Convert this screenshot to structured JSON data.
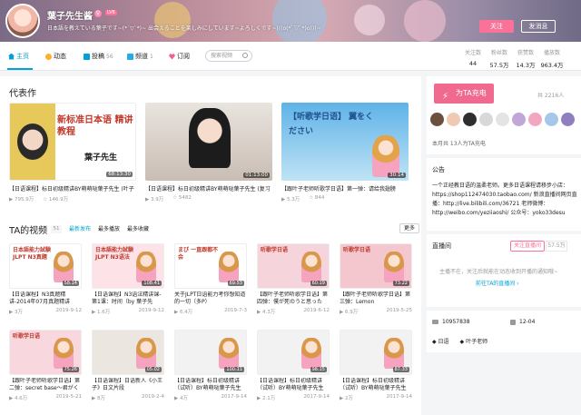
{
  "header": {
    "username": "葉子先生酱",
    "level": "LV6",
    "signature": "日本語を教えている葉子です~(*´▽`*)~ 出会えることを楽しみにしています~よろしくです~(((o(*ﾟ▽ﾟ*)o)))~",
    "follow_label": "关注",
    "message_label": "发消息"
  },
  "nav": {
    "items": [
      {
        "label": "主页",
        "count": "",
        "icon": "home-icon"
      },
      {
        "label": "动态",
        "count": "",
        "icon": "feed-icon"
      },
      {
        "label": "投稿",
        "count": "56",
        "icon": "upload-icon"
      },
      {
        "label": "频道",
        "count": "1",
        "icon": "channel-icon"
      },
      {
        "label": "订阅",
        "count": "",
        "icon": "subscribe-icon"
      }
    ],
    "search_placeholder": "搜索视频",
    "stats": [
      {
        "label": "关注数",
        "value": "44"
      },
      {
        "label": "粉丝数",
        "value": "57.5万"
      },
      {
        "label": "获赞数",
        "value": "14.3万"
      },
      {
        "label": "播放数",
        "value": "963.4万"
      }
    ]
  },
  "representative": {
    "title": "代表作",
    "videos": [
      {
        "title": "【日语课程】标日初级精讲BY萌萌哒葉子先生 (叶子",
        "duration": "68:13:30",
        "plays": "795.9万",
        "favs": "146.9万",
        "thumb_text": "新标准日本语 精讲教程",
        "sub": "葉子先生"
      },
      {
        "title": "【日语课程】标日初级精讲BY萌萌哒葉子先生 (复习",
        "duration": "01:13:00",
        "plays": "3.9万",
        "favs": "5482",
        "thumb_text": "",
        "sub": ""
      },
      {
        "title": "【跟叶子老师听歌学日语】第一弹：请给我翅膀",
        "duration": "30:14",
        "plays": "5.3万",
        "favs": "844",
        "thumb_text": "【听歌学日语】 翼をください",
        "sub": ""
      }
    ]
  },
  "ta_videos": {
    "title": "TA的视频",
    "count": "51",
    "tabs": [
      "最新发布",
      "最多播放",
      "最多收藏"
    ],
    "more_label": "更多",
    "rows": [
      [
        {
          "title": "【日语课程】N3真题精讲-2014年07月真题精讲（by",
          "duration": "58:14",
          "plays": "3万",
          "date": "2019-9-12",
          "thumb_text": "日本語能力試験 JLPT N3真題"
        },
        {
          "title": "【日语课程】N3语法精讲课-第1课：时间（by 葉子先",
          "duration": "108:41",
          "plays": "1.6万",
          "date": "2019-9-12",
          "thumb_text": "日本語能力試験 JLPT N3语法"
        },
        {
          "title": "关于JLPT日语能力考你想知道的一切（多P）",
          "duration": "69:53",
          "plays": "6.4万",
          "date": "2019-7-3",
          "thumb_text": "まび 一直跟都不会"
        },
        {
          "title": "【跟叶子老师听歌学日语】第四弹：僕が死のうと思った",
          "duration": "60:19",
          "plays": "4.3万",
          "date": "2019-6-12",
          "thumb_text": "听歌学日语"
        },
        {
          "title": "【跟叶子老师听歌学日语】第三弹：Lemon",
          "duration": "73:22",
          "plays": "6.9万",
          "date": "2019-5-25",
          "thumb_text": "听歌学日语"
        }
      ],
      [
        {
          "title": "【跟叶子老师听歌学日语】第二弹：secret base～君がく",
          "duration": "75:26",
          "plays": "4.6万",
          "date": "2019-5-21",
          "thumb_text": "听歌学日语"
        },
        {
          "title": "【日语课程】日语新人《小王子》日文片段",
          "duration": "05:02",
          "plays": "8万",
          "date": "2019-2-4",
          "thumb_text": ""
        },
        {
          "title": "【日语课程】标日初级精讲（试听）BY萌萌哒葉子先生",
          "duration": "100:11",
          "plays": "4万",
          "date": "2017-9-14",
          "thumb_text": ""
        },
        {
          "title": "【日语课程】标日初级精讲（试听）BY萌萌哒葉子先生",
          "duration": "98:15",
          "plays": "2.1万",
          "date": "2017-9-14",
          "thumb_text": ""
        },
        {
          "title": "【日语课程】标日初级精讲（试听）BY萌萌哒葉子先生",
          "duration": "87:33",
          "plays": "2万",
          "date": "2017-9-14",
          "thumb_text": ""
        }
      ]
    ]
  },
  "sidebar": {
    "charge_label": "为TA充电",
    "charge_total": "共 2216人",
    "charge_month": "本月共 13人为TA充电",
    "notice_title": "公告",
    "notice_text": "一个正经教日语的温柔老师。更多日语课程请移步小店：https://shop112474030.taobao.com/ 新浪直播间网页直播：http://live.bilibili.com/36721 老师微博：http://weibo.com/yeziiaoshi/ 公众号：yoko33desu",
    "live_title": "直播间",
    "live_follow": "关注直播间",
    "live_count": "57.5万",
    "live_msg": "主播不在，关注后就能在动态收到开播的通知哦~",
    "live_link": "前往TA的直播间",
    "uid": "10957838",
    "birthday": "12-04",
    "tags": [
      "日语",
      "叶子老师"
    ]
  },
  "colors": {
    "accent": "#00a1d6",
    "pink": "#fb7299",
    "charge": "#f06a90"
  }
}
